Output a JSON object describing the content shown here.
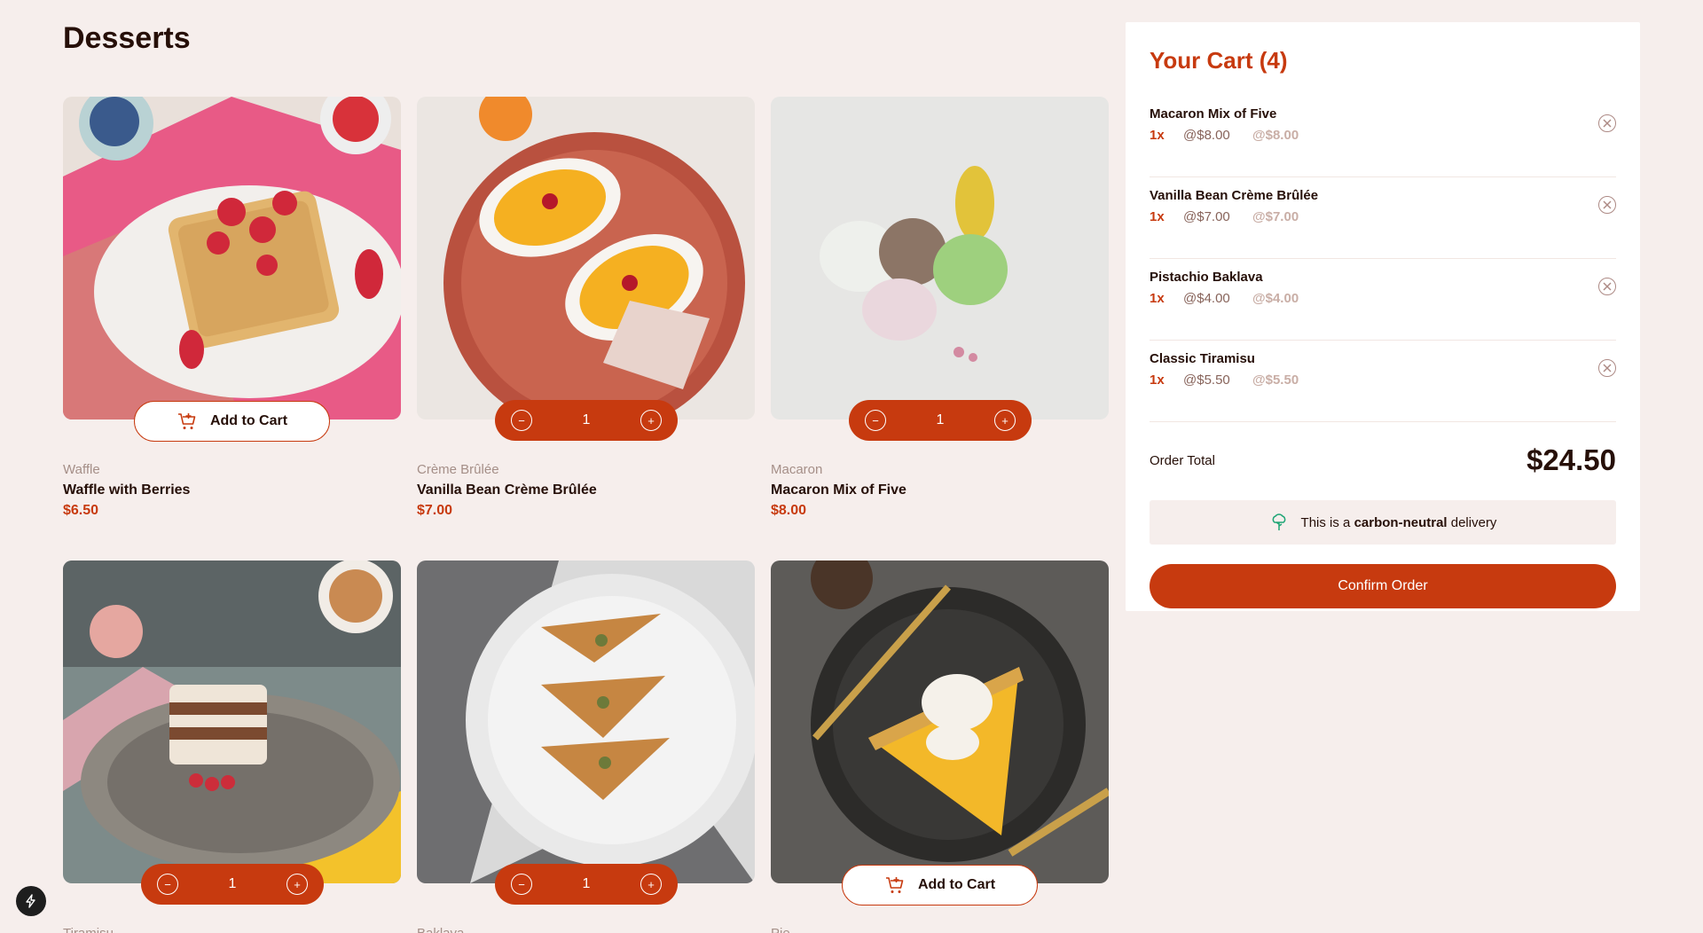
{
  "page": {
    "title": "Desserts"
  },
  "products": [
    {
      "category": "Waffle",
      "name": "Waffle with Berries",
      "price": "$6.50",
      "state": "add",
      "add_label": "Add to Cart"
    },
    {
      "category": "Crème Brûlée",
      "name": "Vanilla Bean Crème Brûlée",
      "price": "$7.00",
      "state": "qty",
      "qty": "1"
    },
    {
      "category": "Macaron",
      "name": "Macaron Mix of Five",
      "price": "$8.00",
      "state": "qty",
      "qty": "1"
    },
    {
      "category": "Tiramisu",
      "name": "",
      "price": "",
      "state": "qty",
      "qty": "1"
    },
    {
      "category": "Baklava",
      "name": "",
      "price": "",
      "state": "qty",
      "qty": "1"
    },
    {
      "category": "Pie",
      "name": "",
      "price": "",
      "state": "add",
      "add_label": "Add to Cart"
    }
  ],
  "stepper": {
    "minus": "−",
    "plus": "+"
  },
  "cart": {
    "title": "Your Cart (4)",
    "items": [
      {
        "name": "Macaron Mix of Five",
        "qty": "1x",
        "unit": "@$8.00",
        "subtotal": "@$8.00"
      },
      {
        "name": "Vanilla Bean Crème Brûlée",
        "qty": "1x",
        "unit": "@$7.00",
        "subtotal": "@$7.00"
      },
      {
        "name": "Pistachio Baklava",
        "qty": "1x",
        "unit": "@$4.00",
        "subtotal": "@$4.00"
      },
      {
        "name": "Classic Tiramisu",
        "qty": "1x",
        "unit": "@$5.50",
        "subtotal": "@$5.50"
      }
    ],
    "total_label": "Order Total",
    "total_value": "$24.50",
    "carbon_pre": "This is a ",
    "carbon_bold": "carbon-neutral",
    "carbon_post": " delivery",
    "confirm_label": "Confirm Order"
  },
  "colors": {
    "accent": "#c73a0f",
    "background": "#f6eeec",
    "text": "#260f08"
  },
  "icons": [
    "add-to-cart-icon",
    "remove-item-icon",
    "tree-icon",
    "lightning-icon"
  ]
}
